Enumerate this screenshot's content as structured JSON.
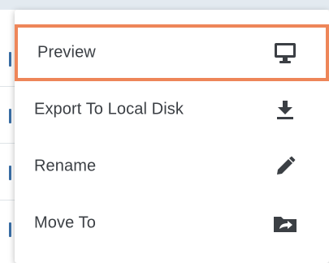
{
  "colors": {
    "highlight_border": "#ee8659",
    "text": "#3b3f44",
    "icon": "#3b3f44",
    "header_background": "#e3eaf0",
    "row_marker": "#3a6ea5"
  },
  "context_menu": {
    "items": [
      {
        "label": "Preview",
        "icon": "monitor-icon",
        "highlighted": true
      },
      {
        "label": "Export To Local Disk",
        "icon": "download-icon",
        "highlighted": false
      },
      {
        "label": "Rename",
        "icon": "pencil-icon",
        "highlighted": false
      },
      {
        "label": "Move To",
        "icon": "move-folder-icon",
        "highlighted": false
      }
    ]
  }
}
